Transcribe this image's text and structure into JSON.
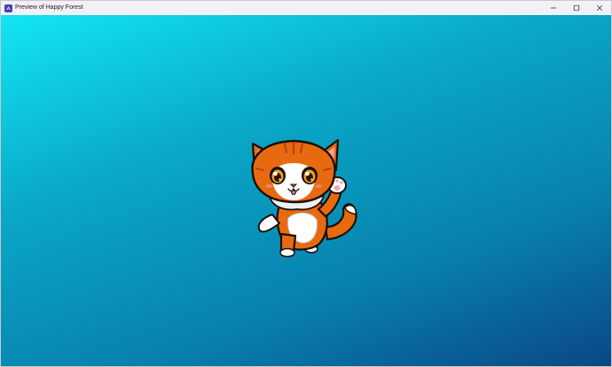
{
  "window": {
    "title": "Preview of Happy Forest",
    "app_icon": "game-engine-icon",
    "controls": [
      "minimize-icon",
      "maximize-icon",
      "close-icon"
    ]
  },
  "scene": {
    "background_colors": [
      "#12e6f3",
      "#0aa8c6",
      "#0880ad",
      "#0a4787"
    ],
    "sprite": "orange-cat-character"
  }
}
